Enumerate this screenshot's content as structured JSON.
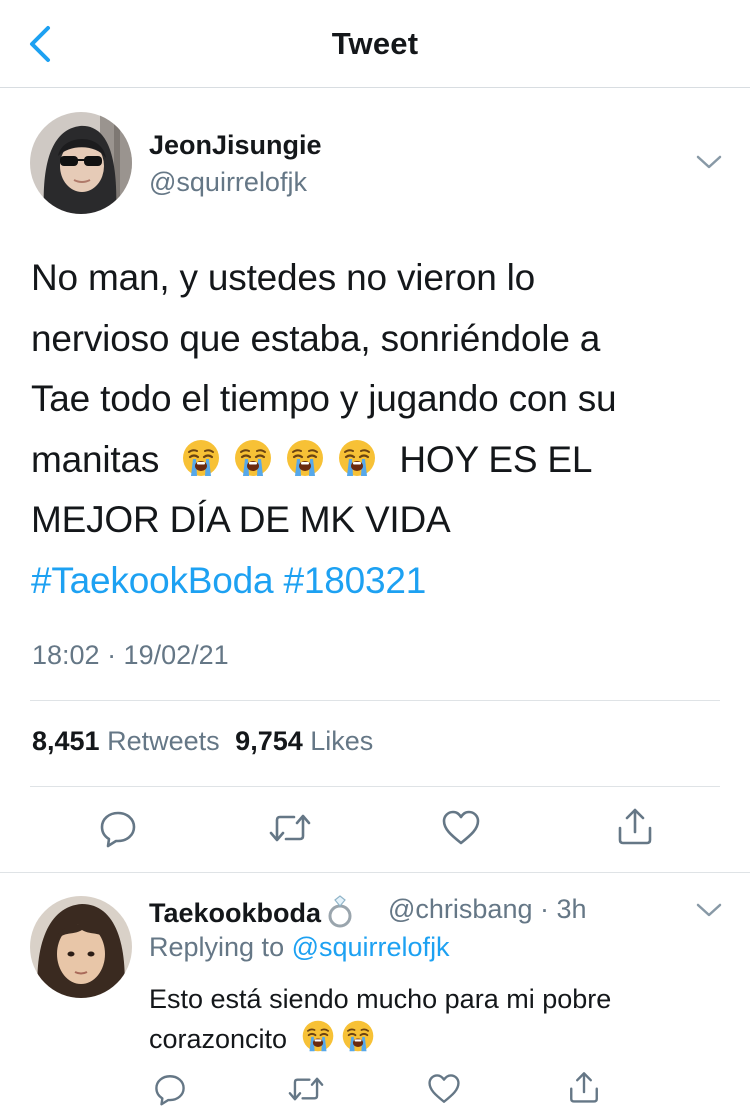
{
  "nav": {
    "title": "Tweet"
  },
  "tweet": {
    "author_name": "JeonJisungie",
    "author_handle": "@squirrelofjk",
    "text_lines": [
      "No man, y ustedes no vieron lo",
      "nervioso que estaba, sonriéndole a",
      "Tae todo el tiempo y jugando con su"
    ],
    "line4_prefix": "manitas",
    "line4_suffix": "HOY ES EL",
    "line5": "MEJOR DÍA DE MK VIDA",
    "hashtags": [
      "#TaekookBoda",
      "#180321"
    ],
    "emoji": "loudly-crying-face",
    "emoji_count": 4,
    "timestamp": "18:02 · 19/02/21",
    "retweets": "8,451",
    "retweets_label": "Retweets",
    "likes": "9,754",
    "likes_label": "Likes"
  },
  "reply": {
    "author_name": "Taekookboda",
    "name_emoji": "ring",
    "author_handle": "@chrisbang · 3h",
    "replying_label": "Replying to",
    "replying_to": "@squirrelofjk",
    "text_line1": "Esto está siendo mucho para mi pobre",
    "text_line2": "corazoncito",
    "emoji": "loudly-crying-face",
    "emoji_count": 2
  },
  "colors": {
    "accent": "#1da1f2",
    "secondary_text": "#657786",
    "primary_text": "#14171a",
    "divider": "#dfe3e6"
  },
  "icons": [
    "back-chevron-icon",
    "chevron-down-icon",
    "reply-icon",
    "retweet-icon",
    "like-icon",
    "share-icon"
  ]
}
